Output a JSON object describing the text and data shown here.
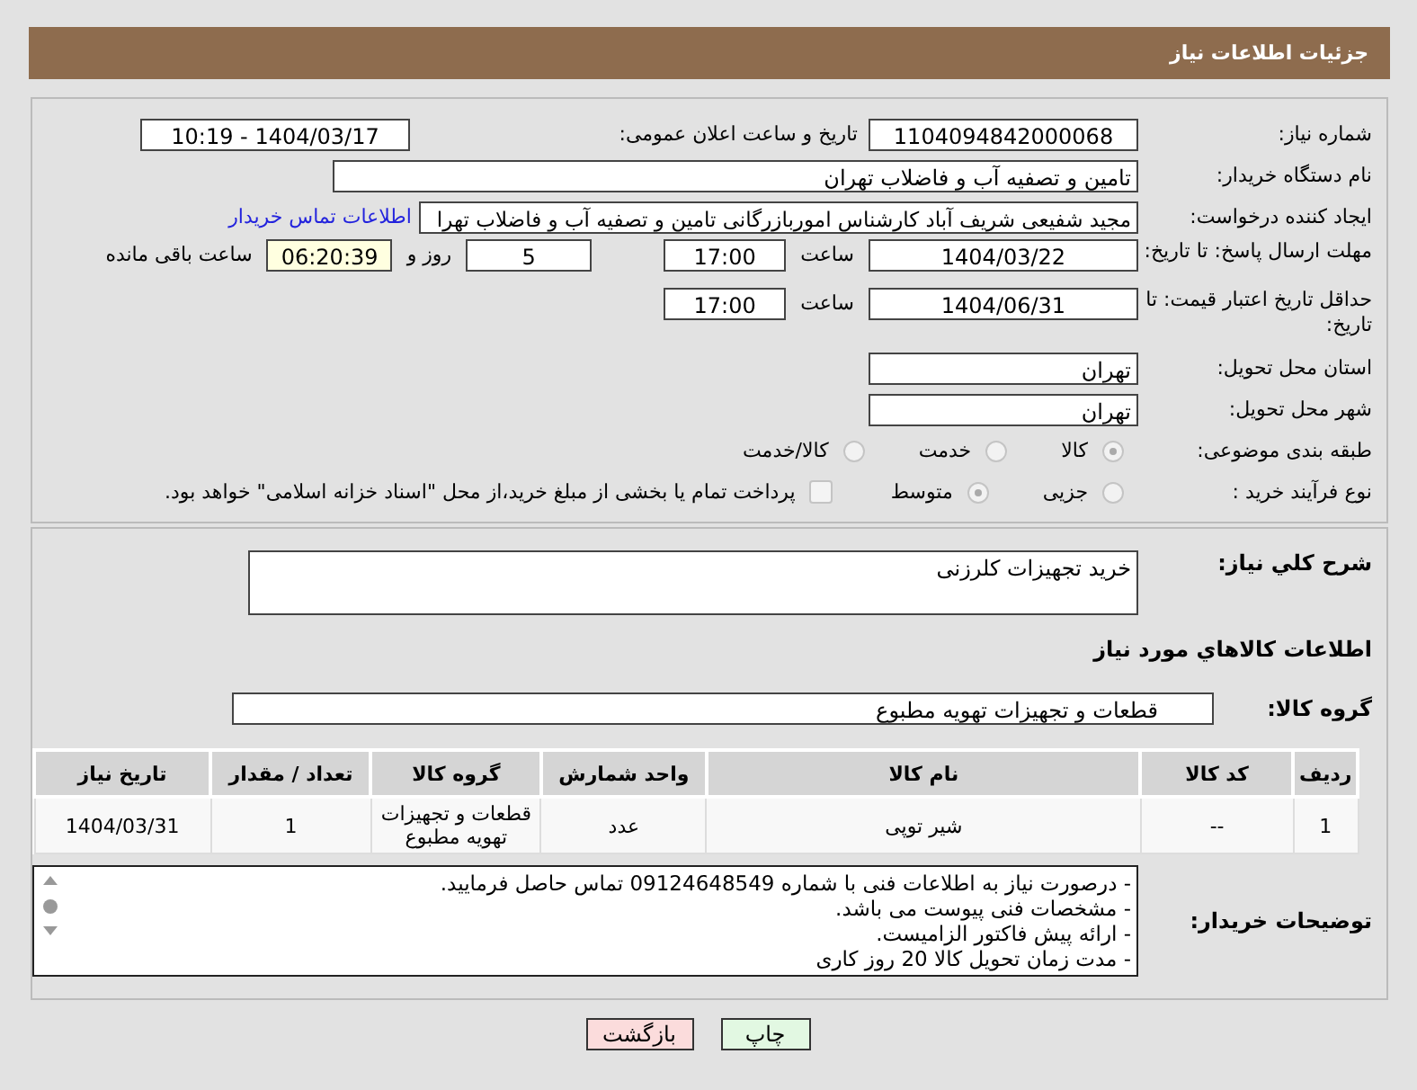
{
  "header": {
    "title": "جزئیات اطلاعات نیاز"
  },
  "details": {
    "need_number": {
      "label": "شماره نیاز:",
      "value": "1104094842000068"
    },
    "announce": {
      "label": "تاریخ و ساعت اعلان عمومی:",
      "value": "1404/03/17 - 10:19"
    },
    "buyer": {
      "label": "نام دستگاه خریدار:",
      "value": "تامین و تصفیه آب و فاضلاب تهران"
    },
    "creator": {
      "label": "ایجاد کننده درخواست:",
      "value": "مجید شفیعی شریف آباد کارشناس اموربازرگانی تامین و تصفیه آب و فاضلاب تهرا",
      "link": "اطلاعات تماس خریدار"
    },
    "deadline": {
      "label": "مهلت ارسال پاسخ: تا تاریخ:",
      "date": "1404/03/22",
      "time_label": "ساعت",
      "time": "17:00",
      "days": "5",
      "days_label": "روز و",
      "remaining": "06:20:39",
      "remaining_label": "ساعت باقی مانده"
    },
    "validity": {
      "label": "حداقل تاریخ اعتبار قیمت: تا تاریخ:",
      "date": "1404/06/31",
      "time_label": "ساعت",
      "time": "17:00"
    },
    "province": {
      "label": "استان محل تحویل:",
      "value": "تهران"
    },
    "city": {
      "label": "شهر محل تحویل:",
      "value": "تهران"
    },
    "category": {
      "label": "طبقه بندی موضوعی:",
      "options": [
        {
          "label": "کالا",
          "selected": true
        },
        {
          "label": "خدمت",
          "selected": false
        },
        {
          "label": "کالا/خدمت",
          "selected": false
        }
      ]
    },
    "process": {
      "label": "نوع فرآیند خرید :",
      "options": [
        {
          "label": "جزیی",
          "selected": false
        },
        {
          "label": "متوسط",
          "selected": true
        }
      ],
      "treasury": {
        "label": "پرداخت تمام یا بخشی از مبلغ خرید،از محل \"اسناد خزانه اسلامی\" خواهد بود.",
        "checked": false
      }
    }
  },
  "goods": {
    "description": {
      "label": "شرح کلي نياز:",
      "value": "خرید تجهیزات کلرزنی"
    },
    "section_title": "اطلاعات کالاهاي مورد نياز",
    "group": {
      "label": "گروه کالا:",
      "value": "قطعات و تجهیزات تهویه مطبوع"
    },
    "table": {
      "columns": [
        "ردیف",
        "کد کالا",
        "نام کالا",
        "واحد شمارش",
        "گروه کالا",
        "تعداد / مقدار",
        "تاریخ نیاز"
      ],
      "rows": [
        [
          "1",
          "--",
          "شیر توپی",
          "عدد",
          "قطعات و تجهیزات تهویه مطبوع",
          "1",
          "1404/03/31"
        ]
      ]
    },
    "notes": {
      "label": "توضیحات خریدار:",
      "lines": [
        "- درصورت نیاز به اطلاعات فنی با شماره 09124648549 تماس حاصل فرمایید.",
        "- مشخصات فنی پیوست می باشد.",
        "- ارائه پیش فاکتور الزامیست.",
        "- مدت زمان تحویل کالا 20 روز کاری"
      ]
    }
  },
  "buttons": [
    {
      "label": "چاپ",
      "kind": "print"
    },
    {
      "label": "بازگشت",
      "kind": "back"
    }
  ]
}
